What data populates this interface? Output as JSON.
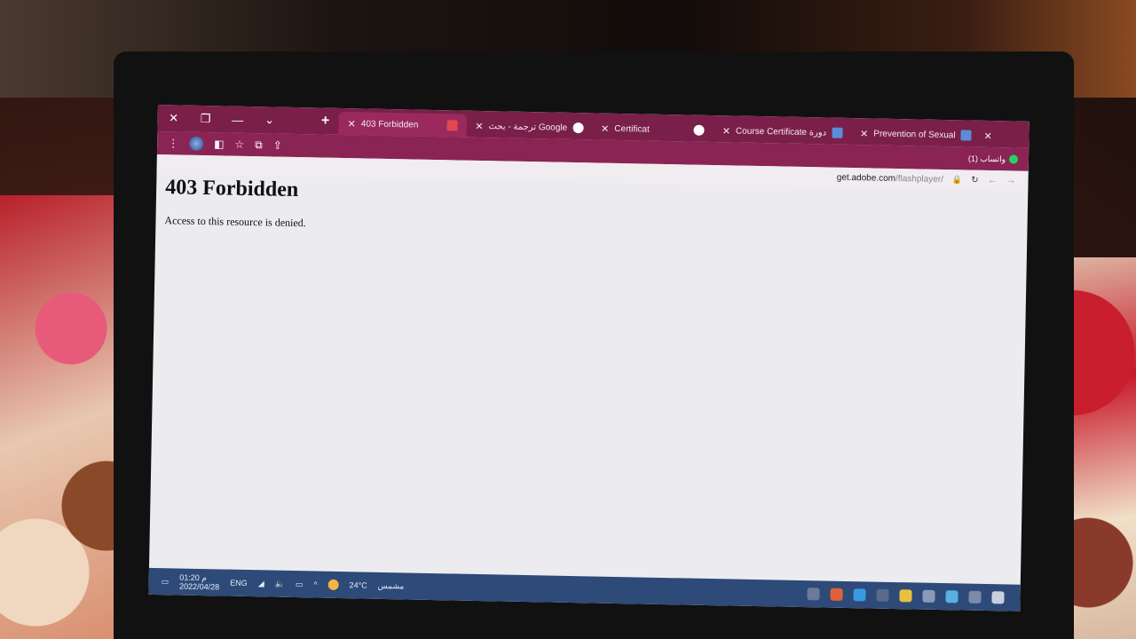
{
  "window_controls": [
    "✕",
    "❐",
    "—",
    "⌄"
  ],
  "new_tab_symbol": "+",
  "tabs": [
    {
      "title": "403 Forbidden",
      "active": true,
      "favicon": "adobe-icon",
      "color": "#e34850"
    },
    {
      "title": "ترجمة - بحث Google",
      "active": false,
      "favicon": "google-icon",
      "color": "#ffffff"
    },
    {
      "title": "Certificat",
      "active": false,
      "favicon": "globe-icon",
      "color": "#ffffff"
    },
    {
      "title": "Course Certificate دورة",
      "active": false,
      "favicon": "course-icon",
      "color": "#5b8cd8"
    },
    {
      "title": "Prevention of Sexual",
      "active": false,
      "favicon": "course-icon",
      "color": "#5b8cd8"
    }
  ],
  "tab_close": "✕",
  "whatsapp_label": "(1) واتساب",
  "url": {
    "host": "get.adobe.com",
    "path": "/flashplayer/"
  },
  "page": {
    "heading": "403 Forbidden",
    "message": "Access to this resource is denied."
  },
  "taskbar": {
    "time": "01:20 م",
    "date": "2022/04/28",
    "language": "ENG",
    "temperature": "24°C",
    "weather": "مشمس"
  },
  "colors": {
    "titlebar": "#7a1f4a",
    "toolbar": "#8a2454",
    "taskbar": "#2e4a78"
  }
}
